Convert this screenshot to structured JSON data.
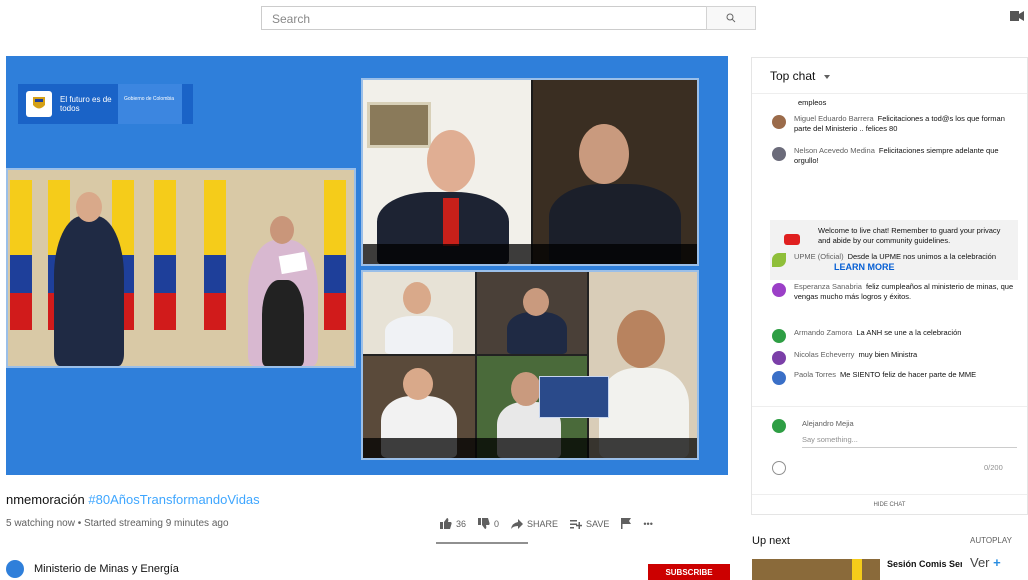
{
  "search": {
    "placeholder": "Search"
  },
  "video": {
    "brand_line1": "El futuro es de todos",
    "brand_line2": "Gobierno de Colombia"
  },
  "info": {
    "title_prefix": "nmemoración ",
    "title_hashtag": "#80AñosTransformandoVidas",
    "meta": "5 watching now • Started streaming 9 minutes ago",
    "likes": "36",
    "dislikes": "0",
    "share_label": "SHARE",
    "save_label": "SAVE",
    "more_label": "•••",
    "channel_name": "Ministerio de Minas y Energía",
    "subscribe_label": "SUBSCRIBE"
  },
  "chat": {
    "header": "Top chat",
    "messages": [
      {
        "author": "",
        "text": "empleos",
        "color": "#ffffff"
      },
      {
        "author": "Miguel Eduardo Barrera",
        "text": "Felicitaciones a tod@s los que forman parte del Ministerio .. felices 80",
        "color": "#9b6b4a"
      },
      {
        "author": "Nelson Acevedo Medina",
        "text": "Felicitaciones siempre adelante que orgullo!",
        "color": "#6b6b7a"
      },
      {
        "author": "UPME (Oficial)",
        "text": "Desde la UPME nos unimos a la celebración",
        "color": "#8fbf3a"
      },
      {
        "author": "Esperanza Sanabria",
        "text": "feliz cumpleaños al ministerio de minas, que vengas mucho más logros y éxitos.",
        "color": "#9b3fc7"
      },
      {
        "author": "Armando Zamora",
        "text": "La ANH se une a la celebración",
        "color": "#2e9e44"
      },
      {
        "author": "Nicolas Echeverry",
        "text": "muy bien Ministra",
        "color": "#7b3fa8"
      },
      {
        "author": "Paola Torres",
        "text": "Me SIENTO feliz de hacer parte de MME",
        "color": "#3a6fc7"
      }
    ],
    "welcome_text": "Welcome to live chat! Remember to guard your privacy and abide by our community guidelines.",
    "learn_more": "LEARN MORE",
    "composer_name": "Alejandro Mejia",
    "composer_placeholder": "Say something...",
    "char_count": "0/200",
    "hide_chat": "HIDE CHAT"
  },
  "upnext": {
    "label": "Up next",
    "autoplay": "AUTOPLAY",
    "next_title": "Sesión Comis Senado",
    "ver_label": "Ver",
    "ver_plus": "+"
  }
}
